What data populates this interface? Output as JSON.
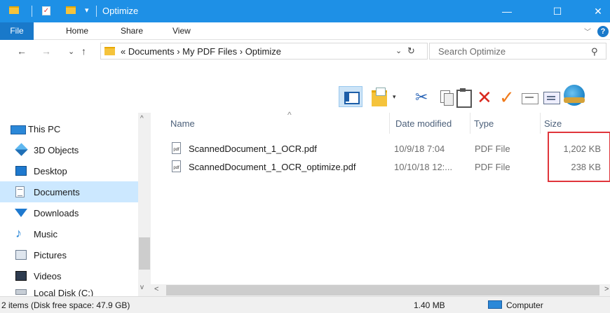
{
  "window": {
    "title": "Optimize",
    "controls": {
      "minimize": "—",
      "maximize": "☐",
      "close": "✕"
    }
  },
  "quick_access": {
    "dropdown_glyph": "▾"
  },
  "ribbon": {
    "tabs": [
      "File",
      "Home",
      "Share",
      "View"
    ],
    "expand_glyph": "﹀",
    "help_glyph": "?"
  },
  "nav": {
    "back": "←",
    "forward": "→",
    "recent": "⌄",
    "up": "↑"
  },
  "address": {
    "path_text": "« Documents  ›  My PDF Files  ›  Optimize",
    "dropdown_glyph": "⌄",
    "refresh_glyph": "↻"
  },
  "search": {
    "placeholder": "Search Optimize",
    "icon_glyph": "⚲"
  },
  "toolbar": {
    "icons": [
      "panes-icon",
      "new-folder-icon",
      "cut-icon",
      "copy-icon",
      "paste-icon",
      "delete-icon",
      "check-icon",
      "rename-icon",
      "properties-icon",
      "shell-icon"
    ],
    "cut_glyph": "✂",
    "delete_glyph": "✕",
    "check_glyph": "✓",
    "dropdown_glyph": "▾"
  },
  "navigation_pane": {
    "items": [
      {
        "label": "This PC",
        "icon": "pc-icon"
      },
      {
        "label": "3D Objects",
        "icon": "3d-objects-icon"
      },
      {
        "label": "Desktop",
        "icon": "desktop-icon"
      },
      {
        "label": "Documents",
        "icon": "documents-icon",
        "selected": true
      },
      {
        "label": "Downloads",
        "icon": "downloads-icon"
      },
      {
        "label": "Music",
        "icon": "music-icon"
      },
      {
        "label": "Pictures",
        "icon": "pictures-icon"
      },
      {
        "label": "Videos",
        "icon": "videos-icon"
      },
      {
        "label": "Local Disk (C:)",
        "icon": "disk-icon"
      }
    ],
    "scroll_up": "^",
    "scroll_down": "v"
  },
  "file_list": {
    "columns": [
      "Name",
      "Date modified",
      "Type",
      "Size"
    ],
    "sort_arrow": "^",
    "rows": [
      {
        "name": "ScannedDocument_1_OCR.pdf",
        "date": "10/9/18 7:04",
        "type": "PDF File",
        "size": "1,202 KB"
      },
      {
        "name": "ScannedDocument_1_OCR_optimize.pdf",
        "date": "10/10/18 12:...",
        "type": "PDF File",
        "size": "238 KB"
      }
    ],
    "pdf_label": "pdf",
    "highlight_color": "#e0353b"
  },
  "hscroll": {
    "left": "<",
    "right": ">"
  },
  "status": {
    "items_text": "2 items (Disk free space: 47.9 GB)",
    "size_text": "1.40 MB",
    "location_text": "Computer"
  },
  "colors": {
    "titlebar": "#1e90e6",
    "file_tab": "#1979ca",
    "selection": "#cce8ff"
  }
}
